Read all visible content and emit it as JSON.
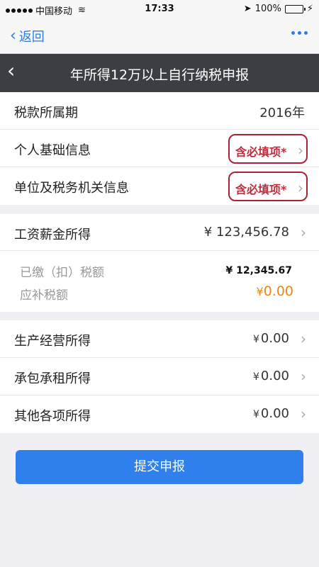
{
  "status_bar": {
    "carrier": "中国移动",
    "time": "17:33",
    "battery": "100%",
    "wifi_icon": "wifi-icon",
    "location_icon": "location-arrow-icon",
    "charging_icon": "bolt-icon"
  },
  "nav": {
    "back_label": "返回"
  },
  "header": {
    "title": "年所得12万以上自行纳税申报"
  },
  "tax_period": {
    "label": "税款所属期",
    "value": "2016年"
  },
  "personal_info": {
    "label": "个人基础信息",
    "required": "含必填项*"
  },
  "unit_info": {
    "label": "单位及税务机关信息",
    "required": "含必填项*"
  },
  "salary": {
    "label": "工资薪金所得",
    "amount": "¥ 123,456.78",
    "paid_label": "已缴（扣）税额",
    "paid_amount": "¥  12,345.67",
    "due_label": "应补税额",
    "due_yen": "¥",
    "due_amount": "0.00"
  },
  "income_rows": [
    {
      "label": "生产经营所得",
      "yen": "¥",
      "amount": "0.00"
    },
    {
      "label": "承包承租所得",
      "yen": "¥",
      "amount": "0.00"
    },
    {
      "label": "其他各项所得",
      "yen": "¥",
      "amount": "0.00"
    }
  ],
  "submit_label": "提交申报",
  "colors": {
    "accent": "#2f80ed",
    "header_bg": "#3b3f44",
    "required": "#c02c3c",
    "due": "#e08a1e"
  }
}
